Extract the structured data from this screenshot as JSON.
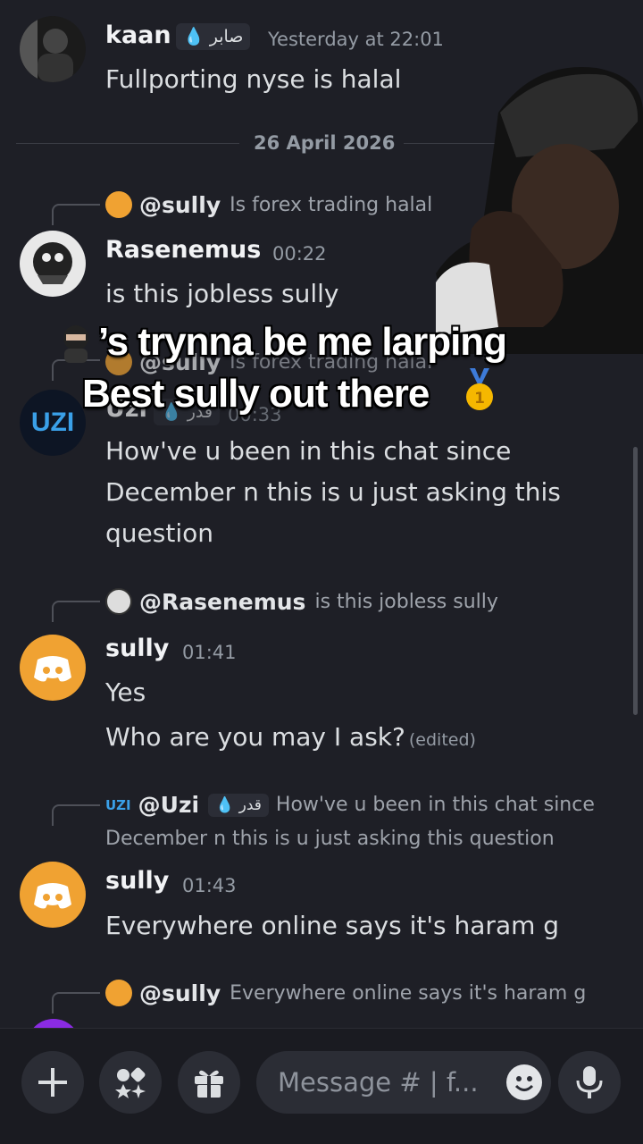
{
  "messages": {
    "kaan": {
      "name": "kaan",
      "tag": "صابر",
      "time": "Yesterday at 22:01",
      "text": "Fullporting nyse is halal"
    },
    "date_divider": "26 April 2026",
    "rasenemus": {
      "reply_to": "@sully",
      "reply_text": "Is forex trading halal",
      "name": "Rasenemus",
      "time": "00:22",
      "text": "is this jobless sully"
    },
    "uzi": {
      "reply_to": "@sully",
      "reply_text": "Is forex trading halal",
      "name": "Uzi",
      "tag": "قدر",
      "time": "00:33",
      "lines": [
        "How've u been in this chat since",
        "December n this is u just asking this",
        "question"
      ]
    },
    "sully1": {
      "reply_to": "@Rasenemus",
      "reply_text": "is this jobless sully",
      "name": "sully",
      "time": "01:41",
      "line1": "Yes",
      "line2": "Who are you may I ask?",
      "edited": "(edited)"
    },
    "sully2": {
      "reply_to": "@Uzi",
      "reply_tag": "قدر",
      "reply_text": "How've u been in this chat since",
      "reply_text2": "December n this is u just asking this question",
      "name": "sully",
      "time": "01:43",
      "text": "Everywhere online says it's haram g"
    },
    "next_reply": {
      "reply_to": "@sully",
      "reply_text": "Everywhere online says it's haram g"
    }
  },
  "overlay": {
    "line1": "’s trynna be me larping",
    "line2": "Best sully out there"
  },
  "composer": {
    "placeholder": "Message # | f..."
  },
  "icons": {
    "add": "plus-icon",
    "apps": "apps-icon",
    "gift": "gift-icon",
    "emoji": "emoji-icon",
    "mic": "microphone-icon"
  },
  "colors": {
    "background": "#1e1f26",
    "discord_orange": "#f0a232",
    "muted": "#949ba4"
  }
}
